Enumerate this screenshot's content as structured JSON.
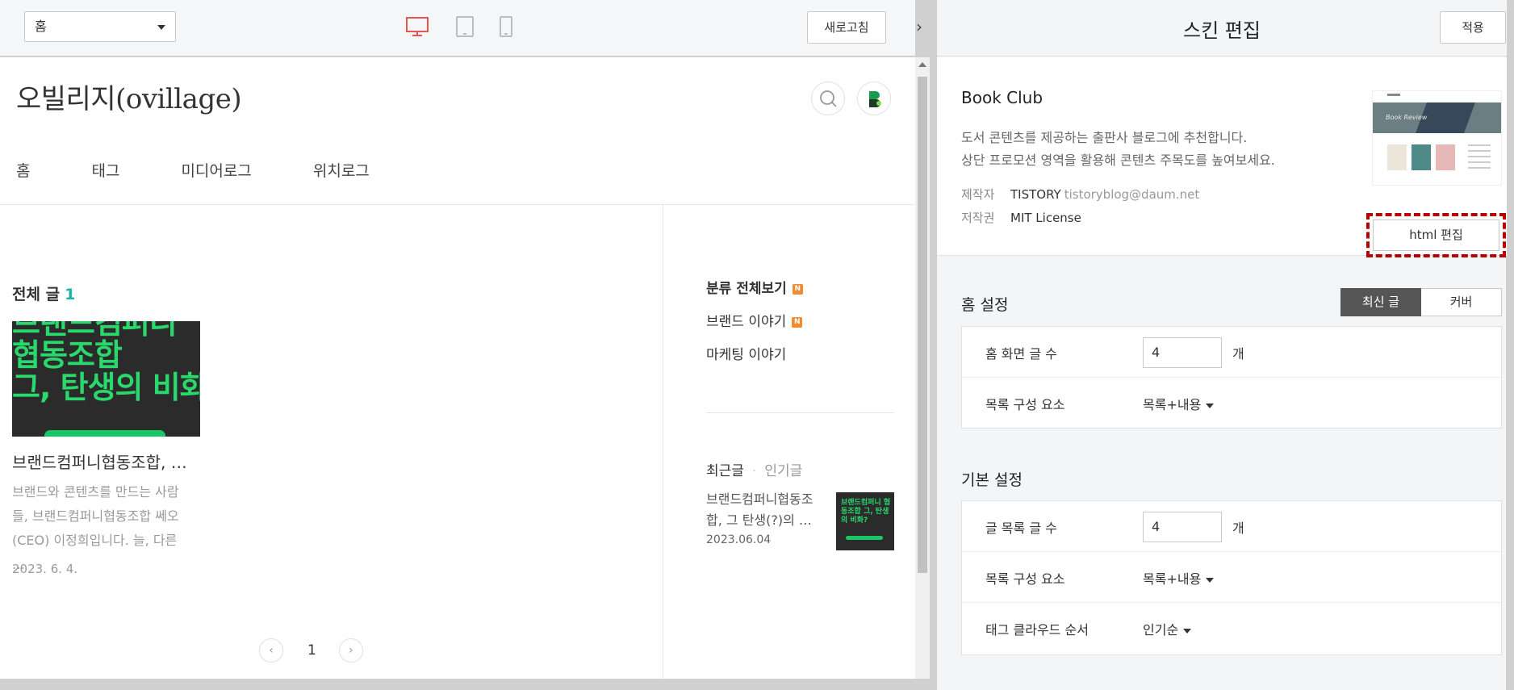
{
  "preview_toolbar": {
    "page_select": "홈",
    "refresh_label": "새로고침",
    "collapse_glyph": "›"
  },
  "blog": {
    "title": "오빌리지(ovillage)",
    "nav": [
      "홈",
      "태그",
      "미디어로그",
      "위치로그"
    ],
    "all_posts_label": "전체 글",
    "all_posts_count": "1",
    "post": {
      "thumb_text": [
        "브랜드컴퍼니",
        "협동조합",
        "그, 탄생의 비화?"
      ],
      "title": "브랜드컴퍼니협동조합, …",
      "excerpt": "브랜드와 콘텐츠를 만드는 사람들, 브랜드컴퍼니협동조합 쎄오(CEO) 이정희입니다. 늘, 다른 …",
      "date": "2023. 6. 4."
    },
    "pager": {
      "prev": "‹",
      "page": "1",
      "next": "›"
    },
    "categories": [
      {
        "label": "분류 전체보기",
        "badge": "N"
      },
      {
        "label": "브랜드 이야기",
        "badge": "N"
      },
      {
        "label": "마케팅 이야기",
        "badge": ""
      }
    ],
    "recent_tabs": {
      "recent": "최근글",
      "popular": "인기글"
    },
    "recent_post": {
      "title": "브랜드컴퍼니협동조합, 그 탄생(?)의 …",
      "date": "2023.06.04",
      "thumb_text": "브랜드컴퍼니 협동조합 그, 탄생의 비화?"
    }
  },
  "panel": {
    "title": "스킨 편집",
    "apply_label": "적용",
    "skin": {
      "name": "Book Club",
      "desc_line1": "도서 콘텐츠를 제공하는 출판사 블로그에 추천합니다.",
      "desc_line2": "상단 프로모션 영역을 활용해 콘텐츠 주목도를 높여보세요.",
      "maker_label": "제작자",
      "maker_name": "TISTORY",
      "maker_email": "tistoryblog@daum.net",
      "license_label": "저작권",
      "license_value": "MIT License",
      "preview_hero_text": "Book Review",
      "html_edit_label": "html 편집"
    },
    "home_settings": {
      "title": "홈 설정",
      "seg_latest": "최신 글",
      "seg_cover": "커버",
      "post_count_label": "홈 화면 글 수",
      "post_count_value": "4",
      "unit": "개",
      "list_element_label": "목록 구성 요소",
      "list_element_value": "목록+내용"
    },
    "basic_settings": {
      "title": "기본 설정",
      "post_count_label": "글 목록 글 수",
      "post_count_value": "4",
      "unit": "개",
      "list_element_label": "목록 구성 요소",
      "list_element_value": "목록+내용",
      "tag_cloud_label": "태그 클라우드 순서",
      "tag_cloud_value": "인기순"
    }
  },
  "colors": {
    "accent_teal": "#16b6a6",
    "new_badge": "#f08b30",
    "highlight_dashed": "#b80000",
    "device_active": "#e8554e"
  }
}
